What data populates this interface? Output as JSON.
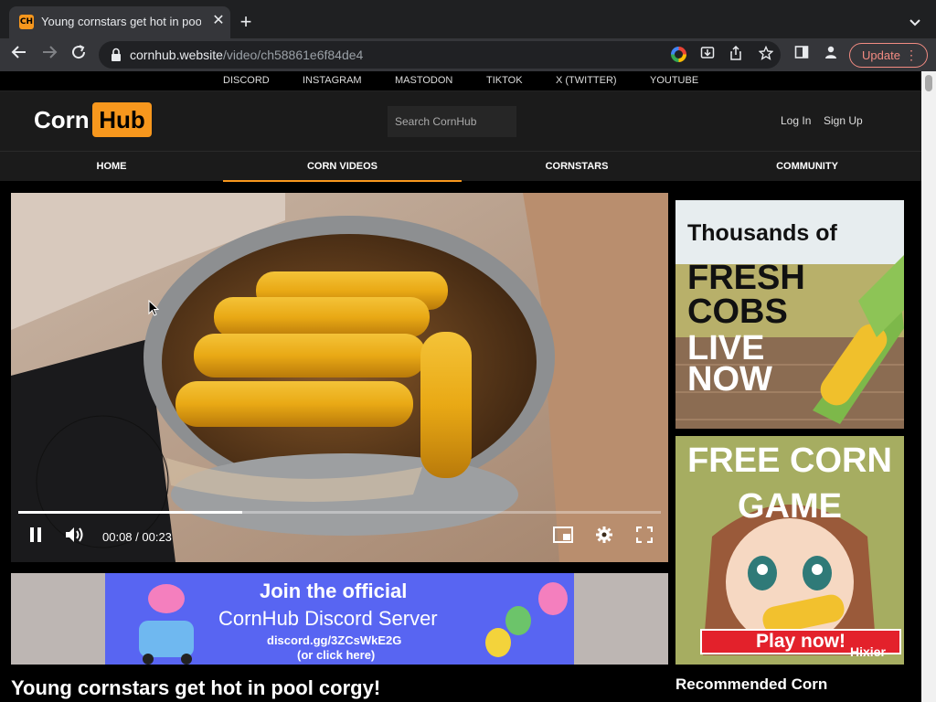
{
  "browser": {
    "tab": {
      "favicon_text": "CH",
      "title": "Young cornstars get hot in pool corgy!",
      "close": "✕"
    },
    "new_tab": "+",
    "tab_menu": "⌄",
    "url_host": "cornhub.website",
    "url_path": "/video/ch58861e6f84de4",
    "update_label": "Update"
  },
  "social_links": [
    "DISCORD",
    "INSTAGRAM",
    "MASTODON",
    "TIKTOK",
    "X (TWITTER)",
    "YOUTUBE"
  ],
  "header": {
    "logo_left": "Corn",
    "logo_right": "Hub",
    "search_placeholder": "Search CornHub",
    "login": "Log In",
    "signup": "Sign Up"
  },
  "nav": {
    "items": [
      "HOME",
      "CORN VIDEOS",
      "CORNSTARS",
      "COMMUNITY"
    ],
    "active": "CORN VIDEOS"
  },
  "player": {
    "current_time": "00:08",
    "duration": "00:23",
    "time_display": "00:08 / 00:23",
    "progress": 0.348,
    "state": "playing"
  },
  "discord_banner": {
    "line1": "Join the official",
    "line2": "CornHub Discord Server",
    "line3": "discord.gg/3ZCsWkE2G",
    "line4": "(or click here)"
  },
  "video_title": "Young cornstars get hot in pool corgy!",
  "ads": {
    "ad1": {
      "line1": "Thousands of",
      "line2": "FRESH",
      "line3": "COBS",
      "line4": "LIVE",
      "line5": "NOW"
    },
    "ad2": {
      "line1": "FREE CORN",
      "line2": "GAME",
      "button": "Play now!",
      "brand": "Hixier"
    }
  },
  "recommended_title": "Recommended Corn",
  "colors": {
    "accent": "#f7971d",
    "background": "#000000",
    "header": "#1b1b1b",
    "discord": "#5865f2"
  }
}
